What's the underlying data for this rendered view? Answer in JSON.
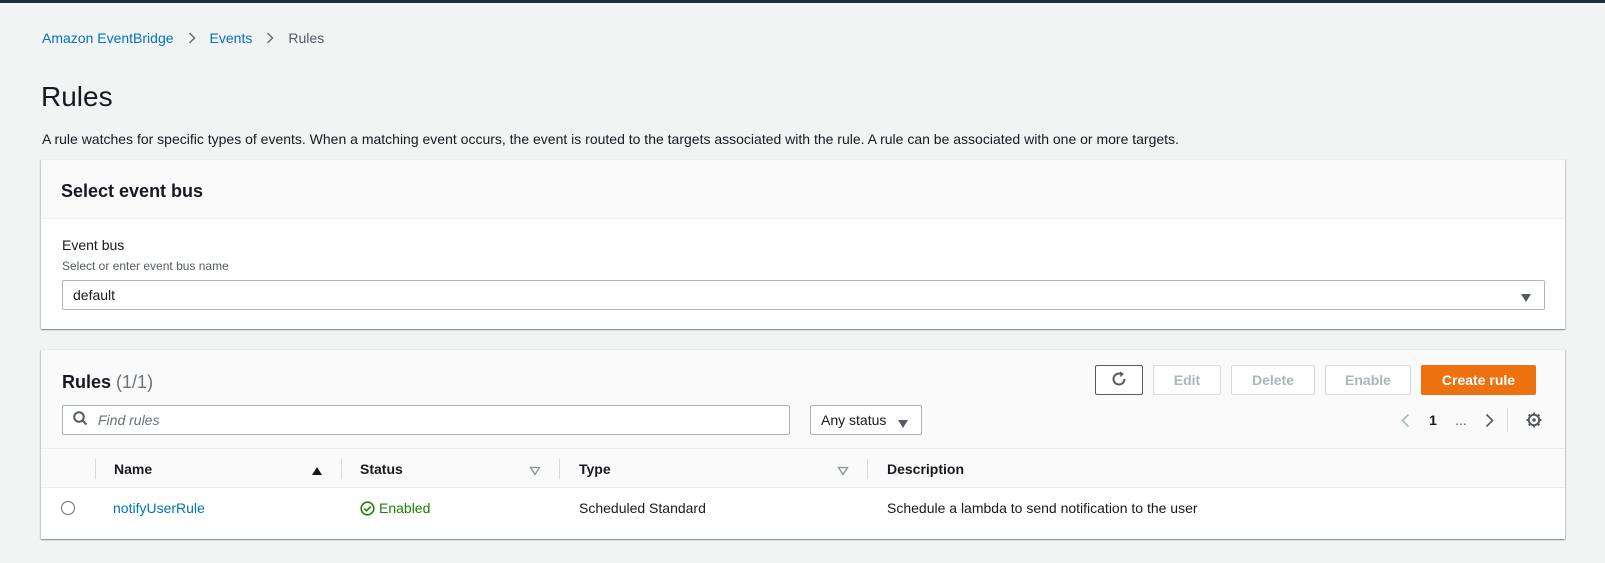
{
  "breadcrumb": {
    "items": [
      "Amazon EventBridge",
      "Events"
    ],
    "current": "Rules"
  },
  "page": {
    "title": "Rules",
    "description": "A rule watches for specific types of events. When a matching event occurs, the event is routed to the targets associated with the rule. A rule can be associated with one or more targets."
  },
  "event_bus_panel": {
    "title": "Select event bus",
    "field_label": "Event bus",
    "field_description": "Select or enter event bus name",
    "selected_value": "default"
  },
  "rules_panel": {
    "title": "Rules",
    "count": "(1/1)",
    "buttons": {
      "edit": "Edit",
      "delete": "Delete",
      "enable": "Enable",
      "create": "Create rule"
    },
    "search_placeholder": "Find rules",
    "status_filter": "Any status",
    "pagination": {
      "current_page": "1",
      "ellipsis": "..."
    },
    "columns": [
      "Name",
      "Status",
      "Type",
      "Description"
    ],
    "rows": [
      {
        "name": "notifyUserRule",
        "status": "Enabled",
        "type": "Scheduled Standard",
        "description": "Schedule a lambda to send notification to the user"
      }
    ]
  },
  "colors": {
    "accent_orange": "#ec7211",
    "link_blue": "#0073bb",
    "success_green": "#1d8102",
    "nav_dark": "#232f3e"
  },
  "icons": [
    "chevron-right-icon",
    "caret-down-icon",
    "refresh-icon",
    "search-icon",
    "chevron-left-icon",
    "gear-icon",
    "sort-ascending-icon",
    "sort-icon",
    "check-circle-icon"
  ]
}
